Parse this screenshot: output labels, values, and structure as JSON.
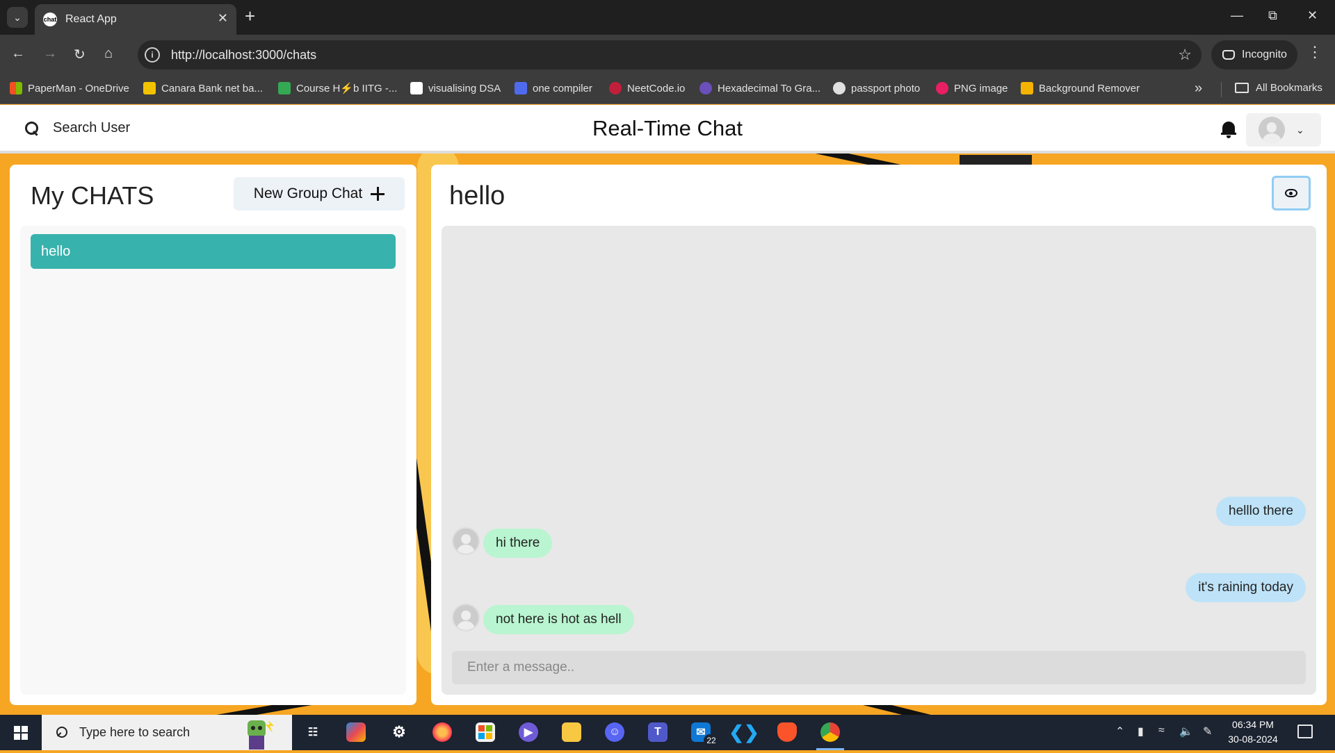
{
  "browser": {
    "tab_title": "React App",
    "tab_favicon_text": "chat",
    "url": "http://localhost:3000/chats",
    "incognito_label": "Incognito",
    "bookmarks": [
      {
        "label": "PaperMan - OneDrive",
        "color": "#f25022"
      },
      {
        "label": "Canara Bank net ba...",
        "color": "#f2c200"
      },
      {
        "label": "Course H⚡b IITG -...",
        "color": "#34a853"
      },
      {
        "label": "visualising DSA",
        "color": "#ffffff"
      },
      {
        "label": "one compiler",
        "color": "#4f6bed"
      },
      {
        "label": "NeetCode.io",
        "color": "#c21f3a"
      },
      {
        "label": "Hexadecimal To Gra...",
        "color": "#6b4fbb"
      },
      {
        "label": "passport photo",
        "color": "#e0e0e0"
      },
      {
        "label": "PNG image",
        "color": "#e91e63"
      },
      {
        "label": "Background Remover",
        "color": "#f5b301"
      }
    ],
    "all_bookmarks_label": "All Bookmarks"
  },
  "header": {
    "search_label": "Search User",
    "title": "Real-Time Chat"
  },
  "my_chats": {
    "title": "My CHATS",
    "new_group_label": "New Group Chat",
    "chats": [
      {
        "name": "hello",
        "selected": true
      }
    ]
  },
  "chat_box": {
    "chat_name": "hello",
    "messages": [
      {
        "text": "helllo there",
        "from": "me"
      },
      {
        "text": "hi there",
        "from": "other"
      },
      {
        "text": "it's raining today",
        "from": "me"
      },
      {
        "text": "not here is hot as hell",
        "from": "other"
      }
    ],
    "input_placeholder": "Enter a message.."
  },
  "taskbar": {
    "search_placeholder": "Type here to search",
    "mail_badge": "22",
    "time": "06:34 PM",
    "date": "30-08-2024"
  },
  "colors": {
    "accent_teal": "#38b2ac",
    "bubble_mine": "#bee3f8",
    "bubble_other": "#b9f5d0",
    "background_orange": "#f6a623"
  }
}
